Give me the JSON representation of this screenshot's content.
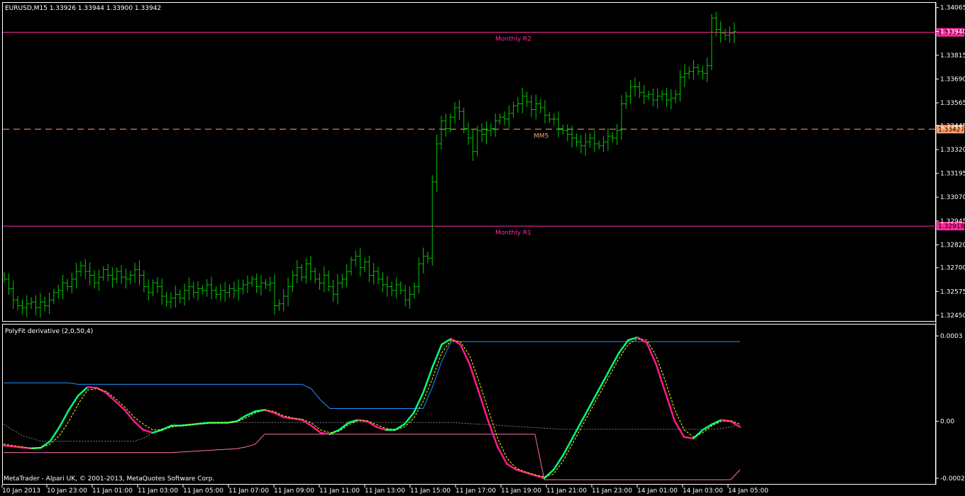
{
  "window": {
    "symbol_header": "EURUSD,M15  1.33926 1.33944 1.33900 1.33942",
    "indicator_header": "PolyFit derivative (2,0,50,4)",
    "copyright": "MetaTrader - Alpari UK, © 2001-2013, MetaQuotes Software Corp."
  },
  "colors": {
    "background": "#000000",
    "frame": "#ffffff",
    "bars": "#00c800",
    "level_magenta": "#ff2aa0",
    "level_orange": "#ff9f6b",
    "deriv_up": "#00ff7f",
    "deriv_down": "#ff1a8c",
    "signal": "#ffff00",
    "upper_band": "#1e90ff",
    "lower_band": "#ff6fae",
    "zero_line": "#808080"
  },
  "chart_data": [
    {
      "type": "ohlc",
      "title": "EURUSD,M15",
      "ylim": [
        1.3242,
        1.3409
      ],
      "yticks": [
        "1.34065",
        "1.33940",
        "1.33815",
        "1.33690",
        "1.33565",
        "1.33445",
        "1.33320",
        "1.33195",
        "1.33070",
        "1.32945",
        "1.32820",
        "1.32700",
        "1.32575",
        "1.32450"
      ],
      "x_ticks": [
        "10 Jan 2013",
        "10 Jan 23:00",
        "11 Jan 01:00",
        "11 Jan 03:00",
        "11 Jan 05:00",
        "11 Jan 07:00",
        "11 Jan 09:00",
        "11 Jan 11:00",
        "11 Jan 13:00",
        "11 Jan 15:00",
        "11 Jan 17:00",
        "11 Jan 19:00",
        "11 Jan 21:00",
        "11 Jan 23:00",
        "14 Jan 01:00",
        "14 Jan 03:00",
        "14 Jan 05:00"
      ],
      "levels": [
        {
          "name": "Monthly R2",
          "value": 1.33935,
          "tag": "1.33935",
          "style": "solid",
          "color": "#ff2aa0"
        },
        {
          "name": "MM5",
          "value": 1.33427,
          "tag": "1.33427",
          "style": "dashed",
          "color": "#ff9f6b"
        },
        {
          "name": "Monthly R1",
          "value": 1.32918,
          "tag": "1.32918",
          "style": "solid",
          "color": "#ff2aa0"
        }
      ],
      "closes": [
        1.3264,
        1.3259,
        1.3253,
        1.325,
        1.3249,
        1.3251,
        1.3252,
        1.3249,
        1.3252,
        1.325,
        1.3253,
        1.3257,
        1.3258,
        1.3262,
        1.326,
        1.3264,
        1.3268,
        1.3271,
        1.3268,
        1.3266,
        1.3262,
        1.3265,
        1.3269,
        1.3266,
        1.3264,
        1.3268,
        1.3265,
        1.3264,
        1.3266,
        1.3269,
        1.3266,
        1.326,
        1.3257,
        1.3262,
        1.326,
        1.3255,
        1.3252,
        1.3254,
        1.3256,
        1.3254,
        1.3258,
        1.326,
        1.3257,
        1.3259,
        1.3258,
        1.3261,
        1.3258,
        1.3256,
        1.3258,
        1.3257,
        1.3259,
        1.3258,
        1.3259,
        1.3261,
        1.3262,
        1.3264,
        1.326,
        1.3262,
        1.3261,
        1.3262,
        1.325,
        1.3251,
        1.3255,
        1.326,
        1.3266,
        1.327,
        1.3265,
        1.3272,
        1.3268,
        1.3264,
        1.3262,
        1.3266,
        1.326,
        1.3256,
        1.3262,
        1.3264,
        1.3268,
        1.3274,
        1.3276,
        1.327,
        1.3273,
        1.3266,
        1.3268,
        1.3264,
        1.3261,
        1.326,
        1.3258,
        1.3261,
        1.3258,
        1.3253,
        1.3256,
        1.326,
        1.3272,
        1.3276,
        1.3275,
        1.3315,
        1.3335,
        1.3347,
        1.3343,
        1.3349,
        1.3354,
        1.3352,
        1.3343,
        1.3338,
        1.3331,
        1.3342,
        1.334,
        1.3342,
        1.3343,
        1.3347,
        1.3349,
        1.3348,
        1.3351,
        1.3355,
        1.3356,
        1.336,
        1.3357,
        1.3353,
        1.3356,
        1.3354,
        1.335,
        1.3348,
        1.3348,
        1.3343,
        1.3342,
        1.334,
        1.3338,
        1.3336,
        1.3334,
        1.3336,
        1.3338,
        1.3335,
        1.3334,
        1.3336,
        1.3339,
        1.3338,
        1.3342,
        1.3356,
        1.336,
        1.3365,
        1.3365,
        1.3362,
        1.336,
        1.3361,
        1.3358,
        1.336,
        1.3361,
        1.3358,
        1.3359,
        1.3361,
        1.337,
        1.3372,
        1.3373,
        1.3375,
        1.3373,
        1.3372,
        1.3376,
        1.3401,
        1.3395,
        1.3393,
        1.3392,
        1.3393,
        1.3394
      ]
    },
    {
      "type": "line",
      "title": "PolyFit derivative (2,0,50,4)",
      "ylim": [
        -0.00022,
        0.00034
      ],
      "yticks": [
        "0.0003",
        "0.00",
        "-0.0002"
      ],
      "series": [
        {
          "role": "derivative",
          "values": [
            -8.5e-05,
            -8.8e-05,
            -9.2e-05,
            -9.5e-05,
            -9.3e-05,
            -7e-05,
            -2e-05,
            4e-05,
            9e-05,
            0.00012,
            0.000118,
            0.0001,
            7e-05,
            4e-05,
            0.0,
            -3e-05,
            -4e-05,
            -3e-05,
            -1.5e-05,
            -1.5e-05,
            -1.2e-05,
            -8e-06,
            -5e-06,
            -5e-06,
            -5e-06,
            0.0,
            2e-05,
            3.5e-05,
            4e-05,
            3e-05,
            1.5e-05,
            1e-05,
            5e-06,
            -1.5e-05,
            -4e-05,
            -4.5e-05,
            -3e-05,
            -5e-06,
            5e-06,
            0.0,
            -2e-05,
            -3e-05,
            -3e-05,
            -1e-05,
            3e-05,
            0.0001,
            0.00019,
            0.00027,
            0.00029,
            0.00027,
            0.0002,
            0.0001,
            0.0,
            -9e-05,
            -0.00015,
            -0.00017,
            -0.00018,
            -0.00019,
            -0.0002,
            -0.00017,
            -0.00012,
            -6e-05,
            0.0,
            6e-05,
            0.00012,
            0.00018,
            0.00024,
            0.000285,
            0.000295,
            0.000275,
            0.0002,
            0.0001,
            0.0,
            -5.5e-05,
            -6e-05,
            -3e-05,
            -1e-05,
            5e-06,
            0.0,
            -2e-05
          ]
        },
        {
          "role": "signal",
          "values": [
            -8e-05,
            -8.5e-05,
            -9e-05,
            -9.5e-05,
            -9.2e-05,
            -8e-05,
            -5e-05,
            0.0,
            6e-05,
            0.00011,
            0.000115,
            0.000105,
            8e-05,
            5e-05,
            1.5e-05,
            -1e-05,
            -3e-05,
            -3e-05,
            -2e-05,
            -1.5e-05,
            -1.2e-05,
            -1e-05,
            -6e-06,
            -5e-06,
            -5e-06,
            -2e-06,
            1.2e-05,
            3e-05,
            4e-05,
            3.5e-05,
            2e-05,
            1.2e-05,
            8e-06,
            -5e-06,
            -3e-05,
            -4e-05,
            -3.5e-05,
            -1.2e-05,
            2e-06,
            2e-06,
            -1.2e-05,
            -2.5e-05,
            -3e-05,
            -2e-05,
            1e-05,
            7e-05,
            0.00015,
            0.00024,
            0.000285,
            0.00028,
            0.00023,
            0.00014,
            4e-05,
            -6e-05,
            -0.00013,
            -0.000165,
            -0.000178,
            -0.000188,
            -0.000195,
            -0.000185,
            -0.00014,
            -8e-05,
            -2e-05,
            4e-05,
            0.0001,
            0.00016,
            0.00022,
            0.00027,
            0.00029,
            0.000285,
            0.00023,
            0.00014,
            4e-05,
            -3e-05,
            -5.5e-05,
            -4e-05,
            -1.5e-05,
            0.0,
            2e-06,
            -1e-05
          ]
        },
        {
          "role": "upper",
          "values": [
            0.000135,
            0.000135,
            0.000135,
            0.000135,
            0.000135,
            0.000135,
            0.000135,
            0.000135,
            0.00013,
            0.00013,
            0.00013,
            0.00013,
            0.00013,
            0.00013,
            0.00013,
            0.00013,
            0.00013,
            0.00013,
            0.00013,
            0.00013,
            0.00013,
            0.00013,
            0.00013,
            0.00013,
            0.00013,
            0.00013,
            0.00013,
            0.00013,
            0.00013,
            0.00013,
            0.00013,
            0.00013,
            0.00013,
            0.000115,
            7.5e-05,
            4.5e-05,
            4.5e-05,
            4.5e-05,
            4.5e-05,
            4.5e-05,
            4.5e-05,
            4.5e-05,
            4.5e-05,
            4.5e-05,
            4.5e-05,
            4.5e-05,
            0.00012,
            0.00021,
            0.00028,
            0.00028,
            0.00028,
            0.00028,
            0.00028,
            0.00028,
            0.00028,
            0.00028,
            0.00028,
            0.00028,
            0.00028,
            0.00028,
            0.00028,
            0.00028,
            0.00028,
            0.00028,
            0.00028,
            0.00028,
            0.00028,
            0.00028,
            0.00028,
            0.00028,
            0.00028,
            0.00028,
            0.00028,
            0.00028,
            0.00028,
            0.00028,
            0.00028,
            0.00028,
            0.00028,
            0.00028
          ]
        },
        {
          "role": "lower",
          "values": [
            -0.00011,
            -0.00011,
            -0.00011,
            -0.00011,
            -0.00011,
            -0.00011,
            -0.00011,
            -0.00011,
            -0.00011,
            -0.00011,
            -0.00011,
            -0.00011,
            -0.00011,
            -0.00011,
            -0.00011,
            -0.00011,
            -0.00011,
            -0.00011,
            -0.00011,
            -0.000108,
            -0.000106,
            -0.000104,
            -0.000102,
            -0.0001,
            -9.8e-05,
            -9.6e-05,
            -9e-05,
            -8e-05,
            -4.5e-05,
            -4.5e-05,
            -4.5e-05,
            -4.5e-05,
            -4.5e-05,
            -4.5e-05,
            -4.5e-05,
            -4.5e-05,
            -4.5e-05,
            -4.5e-05,
            -4.5e-05,
            -4.5e-05,
            -4.5e-05,
            -4.5e-05,
            -4.5e-05,
            -4.5e-05,
            -4.5e-05,
            -4.5e-05,
            -4.5e-05,
            -4.5e-05,
            -4.5e-05,
            -4.5e-05,
            -4.5e-05,
            -4.5e-05,
            -4.5e-05,
            -4.5e-05,
            -4.5e-05,
            -4.5e-05,
            -4.5e-05,
            -4.5e-05,
            -0.000205,
            -0.000205,
            -0.000205,
            -0.000205,
            -0.000205,
            -0.000205,
            -0.000205,
            -0.000205,
            -0.000205,
            -0.000205,
            -0.000205,
            -0.000205,
            -0.000205,
            -0.000205,
            -0.000205,
            -0.000205,
            -0.000205,
            -0.000205,
            -0.000205,
            -0.000205,
            -0.000205,
            -0.00017
          ]
        },
        {
          "role": "mean",
          "values": [
            -1e-05,
            -3e-05,
            -5e-05,
            -6e-05,
            -7e-05,
            -7e-05,
            -7e-05,
            -7e-05,
            -7e-05,
            -7e-05,
            -7e-05,
            -7e-05,
            -7e-05,
            -7e-05,
            -7e-05,
            -6e-05,
            -4e-05,
            -2.5e-05,
            -2e-05,
            -1.5e-05,
            -1.2e-05,
            -1e-05,
            -8e-06,
            -6e-06,
            -5e-06,
            -4e-06,
            -4e-06,
            -4e-06,
            -4e-06,
            -4e-06,
            -4e-06,
            -4e-06,
            -4e-06,
            -4e-06,
            -4e-06,
            -4e-06,
            -4e-06,
            -4e-06,
            -4e-06,
            -4e-06,
            -4e-06,
            -4e-06,
            -4e-06,
            -4e-06,
            -4e-06,
            -4e-06,
            -4e-06,
            -4e-06,
            -4e-06,
            -6e-06,
            -8e-06,
            -1e-05,
            -1.2e-05,
            -1.4e-05,
            -1.6e-05,
            -1.8e-05,
            -2e-05,
            -2.2e-05,
            -2.4e-05,
            -2.6e-05,
            -2.8e-05,
            -2.8e-05,
            -2.8e-05,
            -2.8e-05,
            -2.8e-05,
            -2.8e-05,
            -2.8e-05,
            -2.8e-05,
            -2.8e-05,
            -2.8e-05,
            -2.8e-05,
            -2.8e-05,
            -2.8e-05,
            -2.8e-05,
            -2.8e-05,
            -2.8e-05,
            -2.8e-05,
            -2.5e-05,
            -2e-05,
            -1e-05
          ]
        }
      ]
    }
  ]
}
